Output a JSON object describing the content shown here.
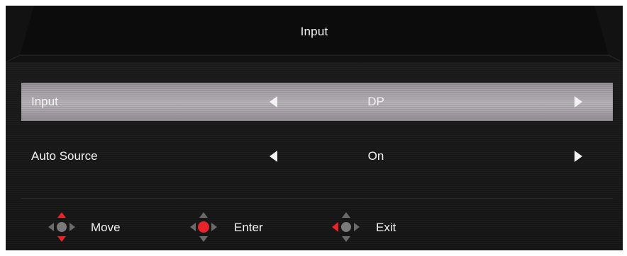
{
  "header": {
    "title": "Input"
  },
  "menu": {
    "items": [
      {
        "label": "Input",
        "value": "DP",
        "selected": true
      },
      {
        "label": "Auto Source",
        "value": "On",
        "selected": false
      }
    ]
  },
  "footer": {
    "move_label": "Move",
    "enter_label": "Enter",
    "exit_label": "Exit"
  },
  "colors": {
    "background": "#1a1a1a",
    "highlight": "#b3aeb3",
    "accent_red": "#e8232a",
    "text": "#f2f2f2"
  },
  "icons": {
    "move": "dpad-up-down-red-icon",
    "enter": "dpad-center-red-icon",
    "exit": "dpad-left-red-icon"
  }
}
